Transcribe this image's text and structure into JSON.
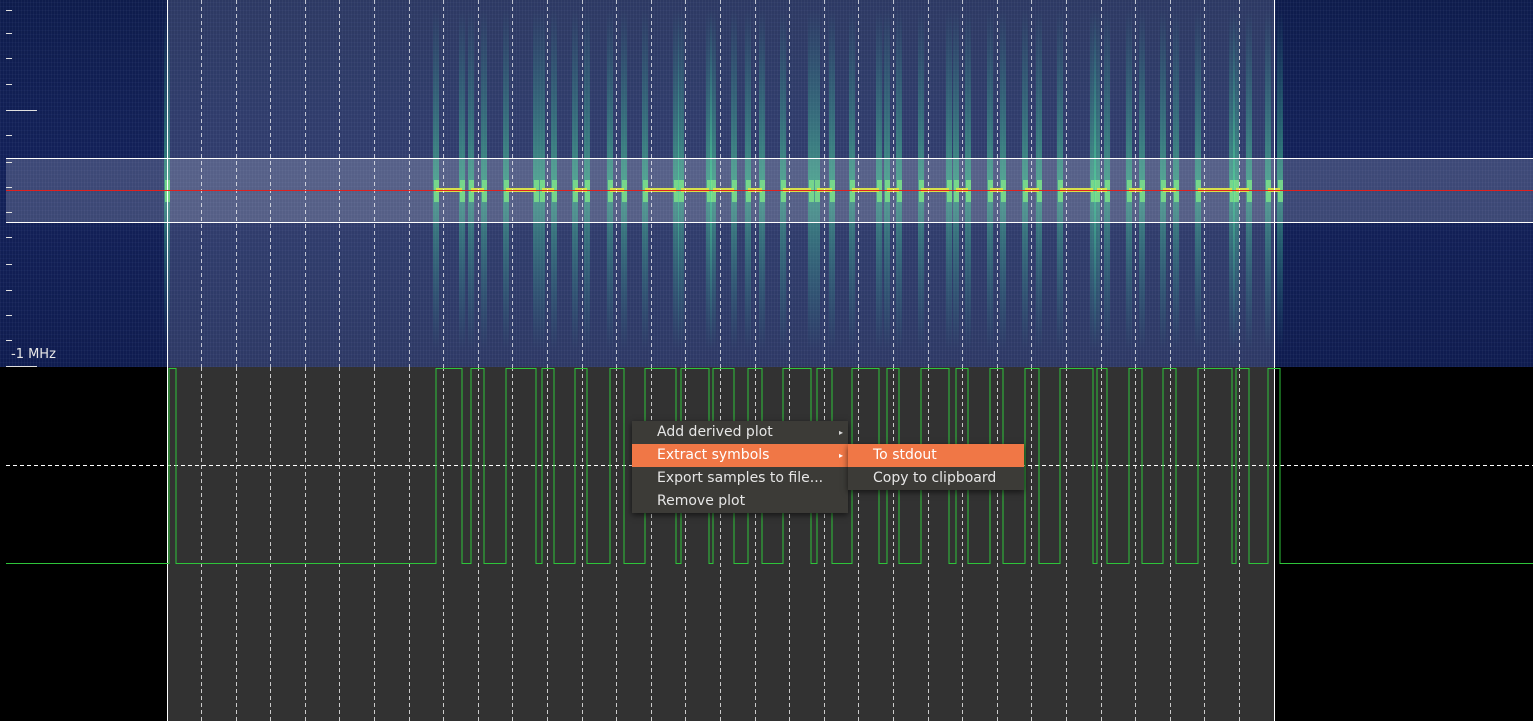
{
  "window": {
    "frequency_label": "-1 MHz"
  },
  "signal": {
    "pulses": [
      [
        436,
        462
      ],
      [
        471,
        484
      ],
      [
        506,
        536
      ],
      [
        542,
        554
      ],
      [
        575,
        587
      ],
      [
        610,
        624
      ],
      [
        645,
        676
      ],
      [
        681,
        709
      ],
      [
        713,
        734
      ],
      [
        748,
        762
      ],
      [
        783,
        811
      ],
      [
        817,
        832
      ],
      [
        852,
        879
      ],
      [
        887,
        899
      ],
      [
        921,
        949
      ],
      [
        956,
        968
      ],
      [
        990,
        1003
      ],
      [
        1025,
        1039
      ],
      [
        1060,
        1093
      ],
      [
        1097,
        1107
      ],
      [
        1129,
        1142
      ],
      [
        1163,
        1176
      ],
      [
        1198,
        1232
      ],
      [
        1236,
        1249
      ],
      [
        1268,
        1280
      ]
    ],
    "highlight_color": "#ffffff",
    "center_line_color": "#e02020",
    "trace_color": "#2ec43a"
  },
  "context_menu": {
    "items": [
      {
        "label": "Add derived plot",
        "has_submenu": true
      },
      {
        "label": "Extract symbols",
        "has_submenu": true,
        "active": true
      },
      {
        "label": "Export samples to file...",
        "has_submenu": false
      },
      {
        "label": "Remove plot",
        "has_submenu": false
      }
    ],
    "submenu": {
      "items": [
        {
          "label": "To stdout",
          "active": true
        },
        {
          "label": "Copy to clipboard",
          "active": false
        }
      ]
    },
    "highlight_color": "#f07746"
  }
}
